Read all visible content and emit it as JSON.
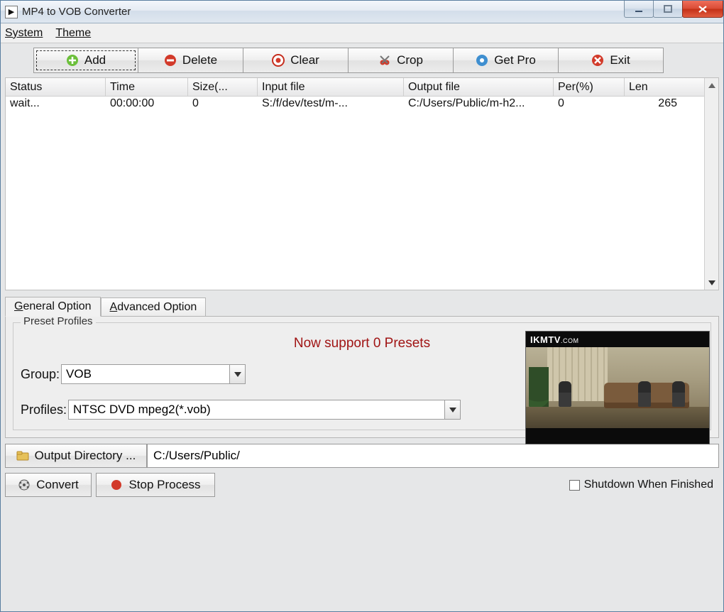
{
  "window": {
    "title": "MP4 to VOB Converter"
  },
  "menubar": {
    "system": "System",
    "theme": "Theme"
  },
  "toolbar": {
    "add": "Add",
    "delete": "Delete",
    "clear": "Clear",
    "crop": "Crop",
    "getpro": "Get Pro",
    "exit": "Exit"
  },
  "table": {
    "headers": {
      "status": "Status",
      "time": "Time",
      "size": "Size(...",
      "input": "Input file",
      "output": "Output file",
      "per": "Per(%)",
      "len": "Len"
    },
    "rows": [
      {
        "status": "wait...",
        "time": "00:00:00",
        "size": "0",
        "input": "S:/f/dev/test/m-...",
        "output": "C:/Users/Public/m-h2...",
        "per": "0",
        "len": "265"
      }
    ]
  },
  "tabs": {
    "general": "General Option",
    "advanced": "Advanced Option"
  },
  "preset": {
    "legend": "Preset Profiles",
    "message": "Now support 0 Presets",
    "group_label": "Group:",
    "group_value": "VOB",
    "profiles_label": "Profiles:",
    "profiles_value": "NTSC DVD mpeg2(*.vob)"
  },
  "preview": {
    "watermark": "IKMTV",
    "watermark_suffix": ".COM"
  },
  "output": {
    "button": "Output Directory ...",
    "path": "C:/Users/Public/"
  },
  "footer": {
    "convert": "Convert",
    "stop": "Stop Process",
    "shutdown": "Shutdown When Finished"
  }
}
